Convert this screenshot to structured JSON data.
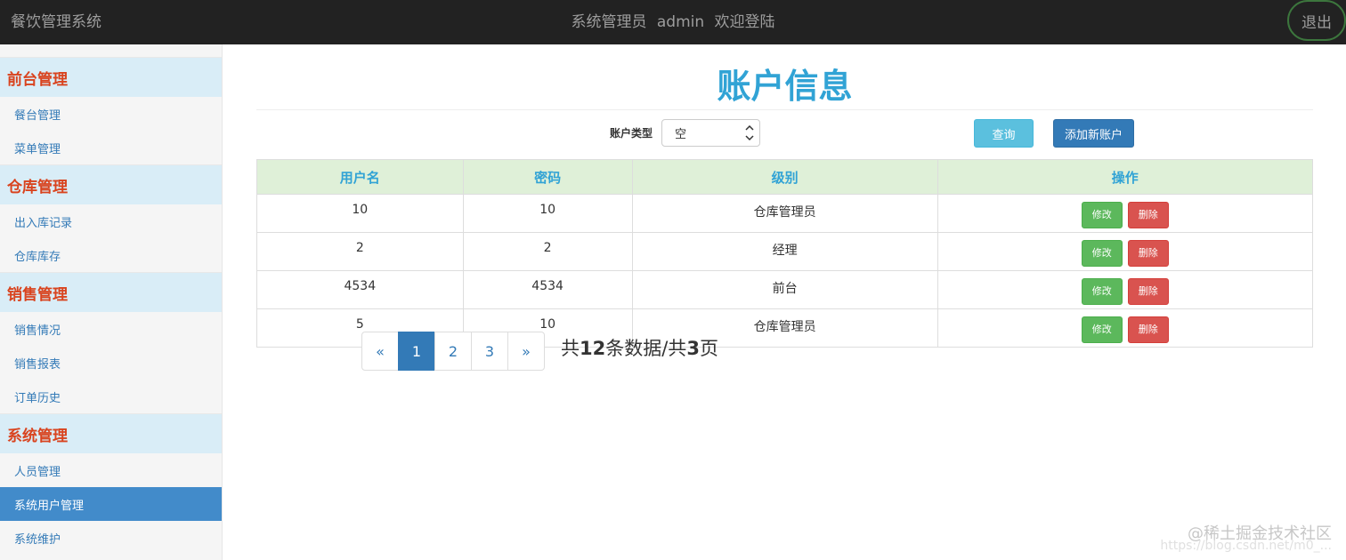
{
  "header": {
    "brand": "餐饮管理系统",
    "role": "系统管理员",
    "user": "admin",
    "welcome": "欢迎登陆",
    "logout": "退出"
  },
  "sidebar": {
    "groups": [
      {
        "title": "前台管理",
        "items": [
          "餐台管理",
          "菜单管理"
        ]
      },
      {
        "title": "仓库管理",
        "items": [
          "出入库记录",
          "仓库库存"
        ]
      },
      {
        "title": "销售管理",
        "items": [
          "销售情况",
          "销售报表",
          "订单历史"
        ]
      },
      {
        "title": "系统管理",
        "items": [
          "人员管理",
          "系统用户管理",
          "系统维护"
        ]
      }
    ],
    "active_item": "系统用户管理"
  },
  "main": {
    "title": "账户信息",
    "filter": {
      "label": "账户类型",
      "selected": "空"
    },
    "query_button": "查询",
    "add_button": "添加新账户",
    "table": {
      "headers": [
        "用户名",
        "密码",
        "级别",
        "操作"
      ],
      "rows": [
        {
          "username": "10",
          "password": "10",
          "level": "仓库管理员"
        },
        {
          "username": "2",
          "password": "2",
          "level": "经理"
        },
        {
          "username": "4534",
          "password": "4534",
          "level": "前台"
        },
        {
          "username": "5",
          "password": "10",
          "level": "仓库管理员"
        }
      ],
      "edit_label": "修改",
      "delete_label": "删除"
    },
    "pagination": {
      "prev": "«",
      "pages": [
        "1",
        "2",
        "3"
      ],
      "current": "1",
      "next": "»",
      "info_prefix": "共",
      "total_count": "12",
      "info_mid": "条数据/共",
      "total_pages": "3",
      "info_suffix": "页"
    }
  },
  "watermark": {
    "text": "@稀土掘金技术社区",
    "url": "https://blog.csdn.net/m0_..."
  },
  "colors": {
    "topbar": "#222222",
    "title": "#31a3d5",
    "group_title": "#d9431e",
    "group_bg": "#d9edf7",
    "active_item": "#428bca",
    "header_row": "#dff0d8"
  }
}
